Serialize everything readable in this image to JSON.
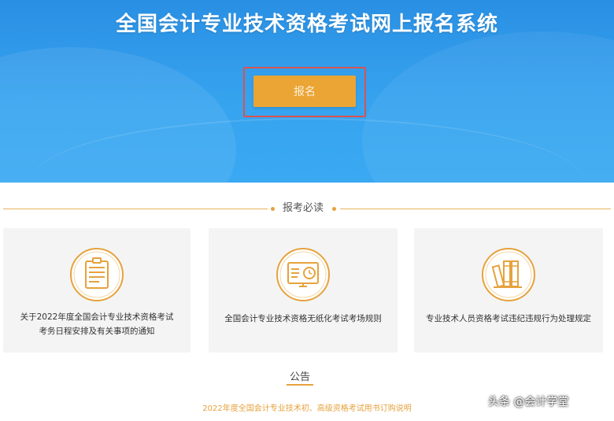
{
  "banner": {
    "title": "全国会计专业技术资格考试网上报名系统",
    "signup_label": "报名"
  },
  "section": {
    "title": "报考必读"
  },
  "cards": [
    {
      "icon": "id-card-icon",
      "line1": "关于2022年度全国会计专业技术资格考试",
      "line2": "考务日程安排及有关事项的通知"
    },
    {
      "icon": "computer-clock-icon",
      "line1": "全国会计专业技术资格无纸化考试考场规则",
      "line2": ""
    },
    {
      "icon": "books-icon",
      "line1": "专业技术人员资格考试违纪违规行为处理规定",
      "line2": ""
    }
  ],
  "notice": {
    "title": "公告",
    "item": "2022年度全国会计专业技术初、高级资格考试用书订购说明"
  },
  "watermark": "头条 @会计学堂",
  "colors": {
    "banner_blue": "#36a3ef",
    "accent_orange": "#eaa535",
    "highlight_red": "#d9534f"
  }
}
